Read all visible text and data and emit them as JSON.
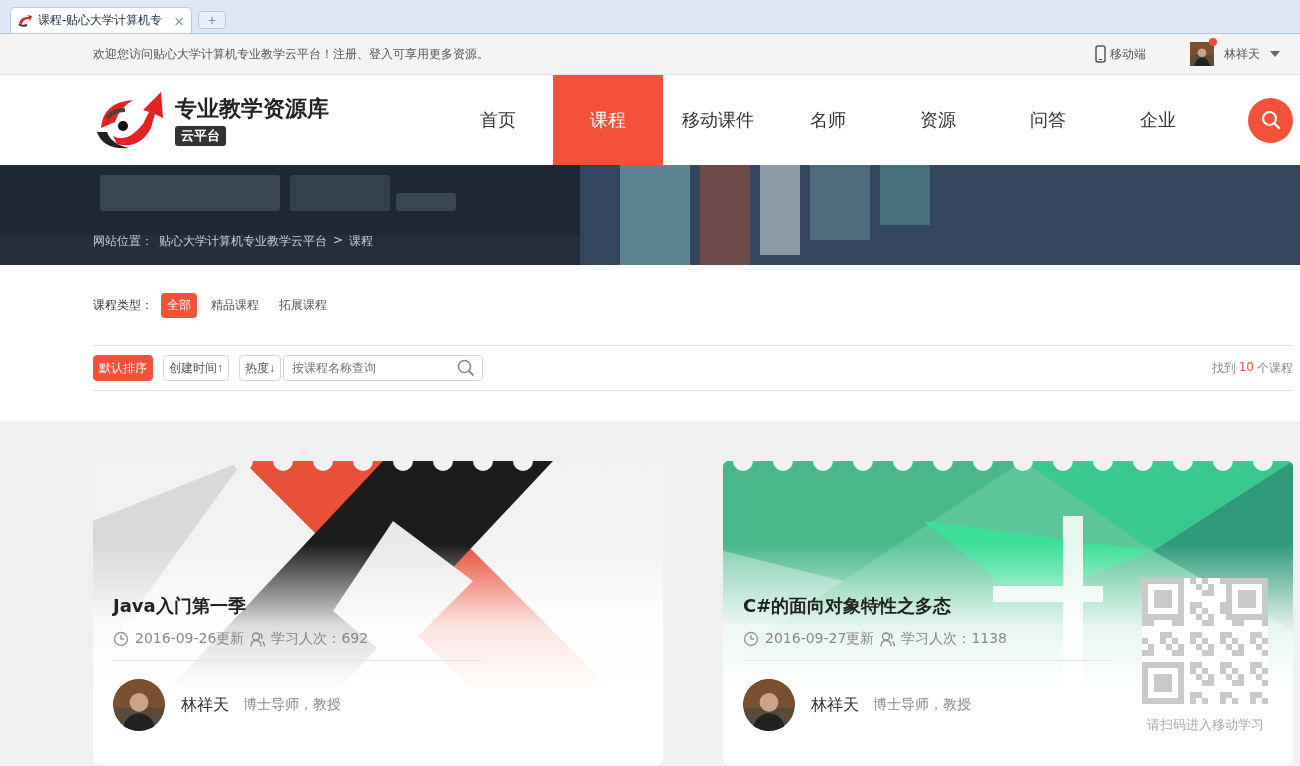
{
  "browser": {
    "tab": {
      "title": "课程-贴心大学计算机专",
      "close": "×"
    },
    "new_tab": "+"
  },
  "top_bar": {
    "welcome": "欢迎您访问贴心大学计算机专业教学云平台！注册、登入可享用更多资源。",
    "mobile": "移动端",
    "user": {
      "name": "林祥天",
      "notification": true
    }
  },
  "logo": {
    "title": "专业教学资源库",
    "badge": "云平台"
  },
  "nav": [
    {
      "label": "首页",
      "selected": false
    },
    {
      "label": "课程",
      "selected": true
    },
    {
      "label": "移动课件",
      "selected": false
    },
    {
      "label": "名师",
      "selected": false
    },
    {
      "label": "资源",
      "selected": false
    },
    {
      "label": "问答",
      "selected": false
    },
    {
      "label": "企业",
      "selected": false
    }
  ],
  "breadcrumb": {
    "label": "网站位置：",
    "items": [
      "贴心大学计算机专业教学云平台",
      "课程"
    ],
    "separator": ">"
  },
  "filter": {
    "label": "课程类型：",
    "options": [
      {
        "label": "全部",
        "selected": true
      },
      {
        "label": "精品课程",
        "selected": false
      },
      {
        "label": "拓展课程",
        "selected": false
      }
    ]
  },
  "sort": [
    {
      "label": "默认排序",
      "selected": true
    },
    {
      "label": "创建时间↑",
      "selected": false
    },
    {
      "label": "热度↓",
      "selected": false
    }
  ],
  "search": {
    "placeholder": "按课程名称查询"
  },
  "result": {
    "prefix": "找到",
    "count": "10",
    "suffix": "个课程"
  },
  "cards": [
    {
      "kind": "java",
      "title": "Java入门第一季",
      "date": "2016-09-26更新",
      "views": "学习人次：692",
      "teacher": "林祥天",
      "teacher_title": "博士导师，教授"
    },
    {
      "kind": "csharp",
      "title": "C#的面向对象特性之多态",
      "date": "2016-09-27更新",
      "views": "学习人次：1138",
      "teacher": "林祥天",
      "teacher_title": "博士导师，教授",
      "qr": {
        "caption": "请扫码进入移动学习"
      }
    }
  ]
}
